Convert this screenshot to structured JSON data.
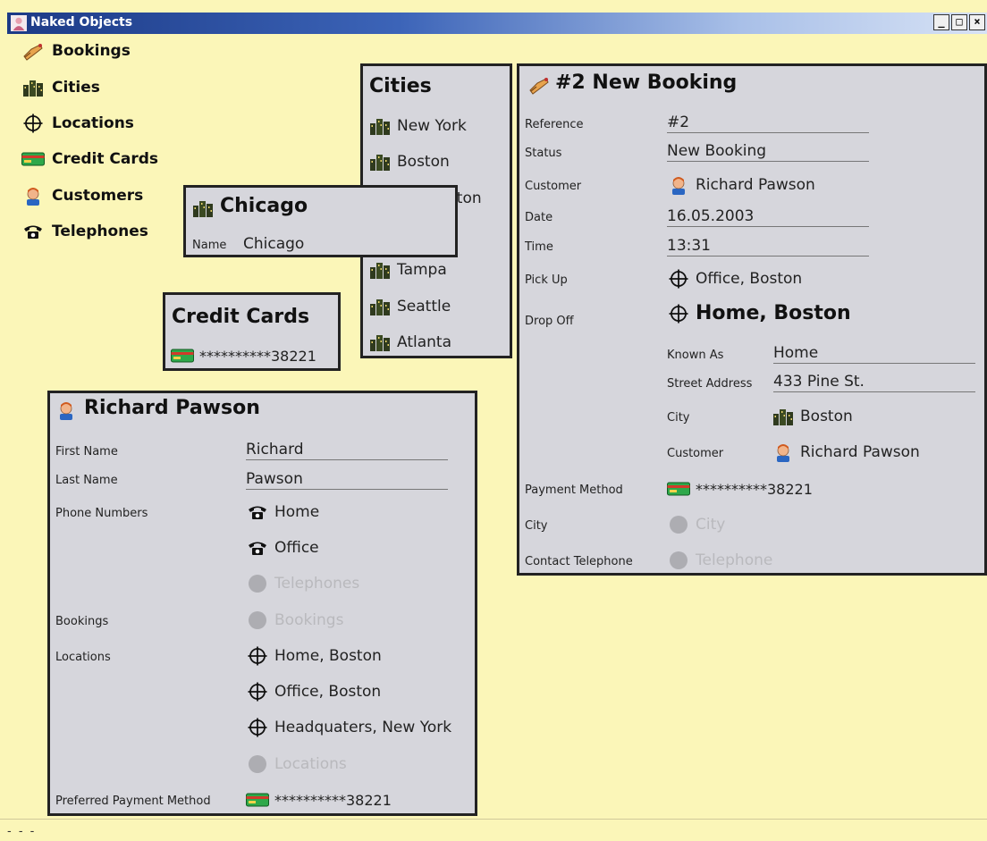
{
  "window": {
    "title": "Naked Objects"
  },
  "desktop": [
    {
      "label": "Bookings",
      "icon": "bookings-icon"
    },
    {
      "label": "Cities",
      "icon": "city-icon"
    },
    {
      "label": "Locations",
      "icon": "location-icon"
    },
    {
      "label": "Credit Cards",
      "icon": "credit-card-icon"
    },
    {
      "label": "Customers",
      "icon": "customer-icon"
    },
    {
      "label": "Telephones",
      "icon": "telephone-icon"
    }
  ],
  "cities_list": {
    "title": "Cities",
    "items": [
      "New York",
      "Boston",
      "gton",
      "",
      "Tampa",
      "Seattle",
      "Atlanta"
    ]
  },
  "chicago": {
    "title": "Chicago",
    "name_label": "Name",
    "name_value": "Chicago"
  },
  "credit_cards": {
    "title": "Credit Cards",
    "card": "**********38221"
  },
  "customer": {
    "title": "Richard Pawson",
    "first_name_label": "First Name",
    "first_name": "Richard",
    "last_name_label": "Last Name",
    "last_name": "Pawson",
    "phones_label": "Phone Numbers",
    "phones": [
      "Home",
      "Office"
    ],
    "phones_empty": "Telephones",
    "bookings_label": "Bookings",
    "bookings_empty": "Bookings",
    "locations_label": "Locations",
    "locations": [
      "Home, Boston",
      "Office, Boston",
      "Headquaters, New York"
    ],
    "locations_empty": "Locations",
    "payment_label": "Preferred Payment Method",
    "payment": "**********38221"
  },
  "booking": {
    "title": "#2 New Booking",
    "reference_label": "Reference",
    "reference": "#2",
    "status_label": "Status",
    "status": "New Booking",
    "customer_label": "Customer",
    "customer": "Richard Pawson",
    "date_label": "Date",
    "date": "16.05.2003",
    "time_label": "Time",
    "time": "13:31",
    "pickup_label": "Pick Up",
    "pickup": "Office, Boston",
    "dropoff_label": "Drop Off",
    "dropoff": "Home, Boston",
    "dropoff_known_as_label": "Known As",
    "dropoff_known_as": "Home",
    "dropoff_street_label": "Street Address",
    "dropoff_street": "433 Pine St.",
    "dropoff_city_label": "City",
    "dropoff_city": "Boston",
    "dropoff_customer_label": "Customer",
    "dropoff_customer": "Richard Pawson",
    "payment_label": "Payment Method",
    "payment": "**********38221",
    "city_label": "City",
    "city_empty": "City",
    "telephone_label": "Contact Telephone",
    "telephone_empty": "Telephone"
  },
  "status_bar": {
    "text": "- - -"
  }
}
